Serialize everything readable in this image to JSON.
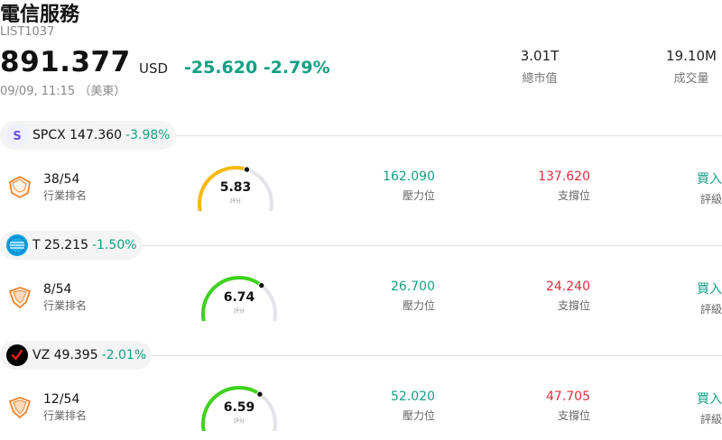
{
  "header": {
    "title": "電信服務",
    "symbol": "LIST1037",
    "price": "891.377",
    "currency": "USD",
    "change": "-25.620 -2.79%",
    "time": "09/09, 11:15 （美東）",
    "market_cap_value": "3.01T",
    "market_cap_label": "總市值",
    "volume_value": "19.10M",
    "volume_label": "成交量"
  },
  "colors": {
    "up_green": "#139f84",
    "down_red": "#e0303e"
  },
  "rows": [
    {
      "ticker": "SPCX 147.360",
      "change": "-3.98%",
      "logo": "spcx-logo",
      "rank": "38/54",
      "rank_label": "行業排名",
      "score": "5.83",
      "score_label": "評分",
      "score_fraction": 0.583,
      "resistance": "162.090",
      "resistance_label": "壓力位",
      "support": "137.620",
      "support_label": "支撐位",
      "rating": "買入",
      "rating_label": "評級"
    },
    {
      "ticker": "T 25.215",
      "change": "-1.50%",
      "logo": "att-logo",
      "rank": "8/54",
      "rank_label": "行業排名",
      "score": "6.74",
      "score_label": "評分",
      "score_fraction": 0.674,
      "resistance": "26.700",
      "resistance_label": "壓力位",
      "support": "24.240",
      "support_label": "支撐位",
      "rating": "買入",
      "rating_label": "評級"
    },
    {
      "ticker": "VZ 49.395",
      "change": "-2.01%",
      "logo": "verizon-logo",
      "rank": "12/54",
      "rank_label": "行業排名",
      "score": "6.59",
      "score_label": "評分",
      "score_fraction": 0.659,
      "resistance": "52.020",
      "resistance_label": "壓力位",
      "support": "47.705",
      "support_label": "支撐位",
      "rating": "買入",
      "rating_label": "評級"
    }
  ]
}
